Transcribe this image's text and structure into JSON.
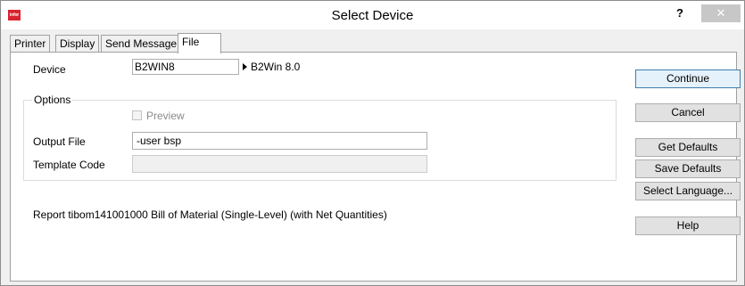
{
  "window": {
    "title": "Select Device",
    "logo_text": "infor",
    "help_glyph": "?",
    "close_glyph": "✕"
  },
  "tabs": [
    {
      "label": "Printer"
    },
    {
      "label": "Display"
    },
    {
      "label": "Send Message"
    },
    {
      "label": "File",
      "active": true
    }
  ],
  "form": {
    "device_label": "Device",
    "device_value": "B2WIN8",
    "device_description": "B2Win 8.0",
    "options_label": "Options",
    "preview_label": "Preview",
    "preview_checked": false,
    "output_file_label": "Output File",
    "output_file_value": "-user bsp",
    "template_code_label": "Template Code",
    "template_code_value": ""
  },
  "report_text": "Report tibom141001000 Bill of Material (Single-Level) (with Net Quantities)",
  "buttons": {
    "continue": "Continue",
    "cancel": "Cancel",
    "get_defaults": "Get Defaults",
    "save_defaults": "Save Defaults",
    "select_language": "Select Language...",
    "help": "Help"
  },
  "colors": {
    "brand": "#d9232e",
    "window_bg": "#f0f0f0",
    "panel_bg": "#ffffff",
    "default_button_border": "#3c7fb1"
  }
}
